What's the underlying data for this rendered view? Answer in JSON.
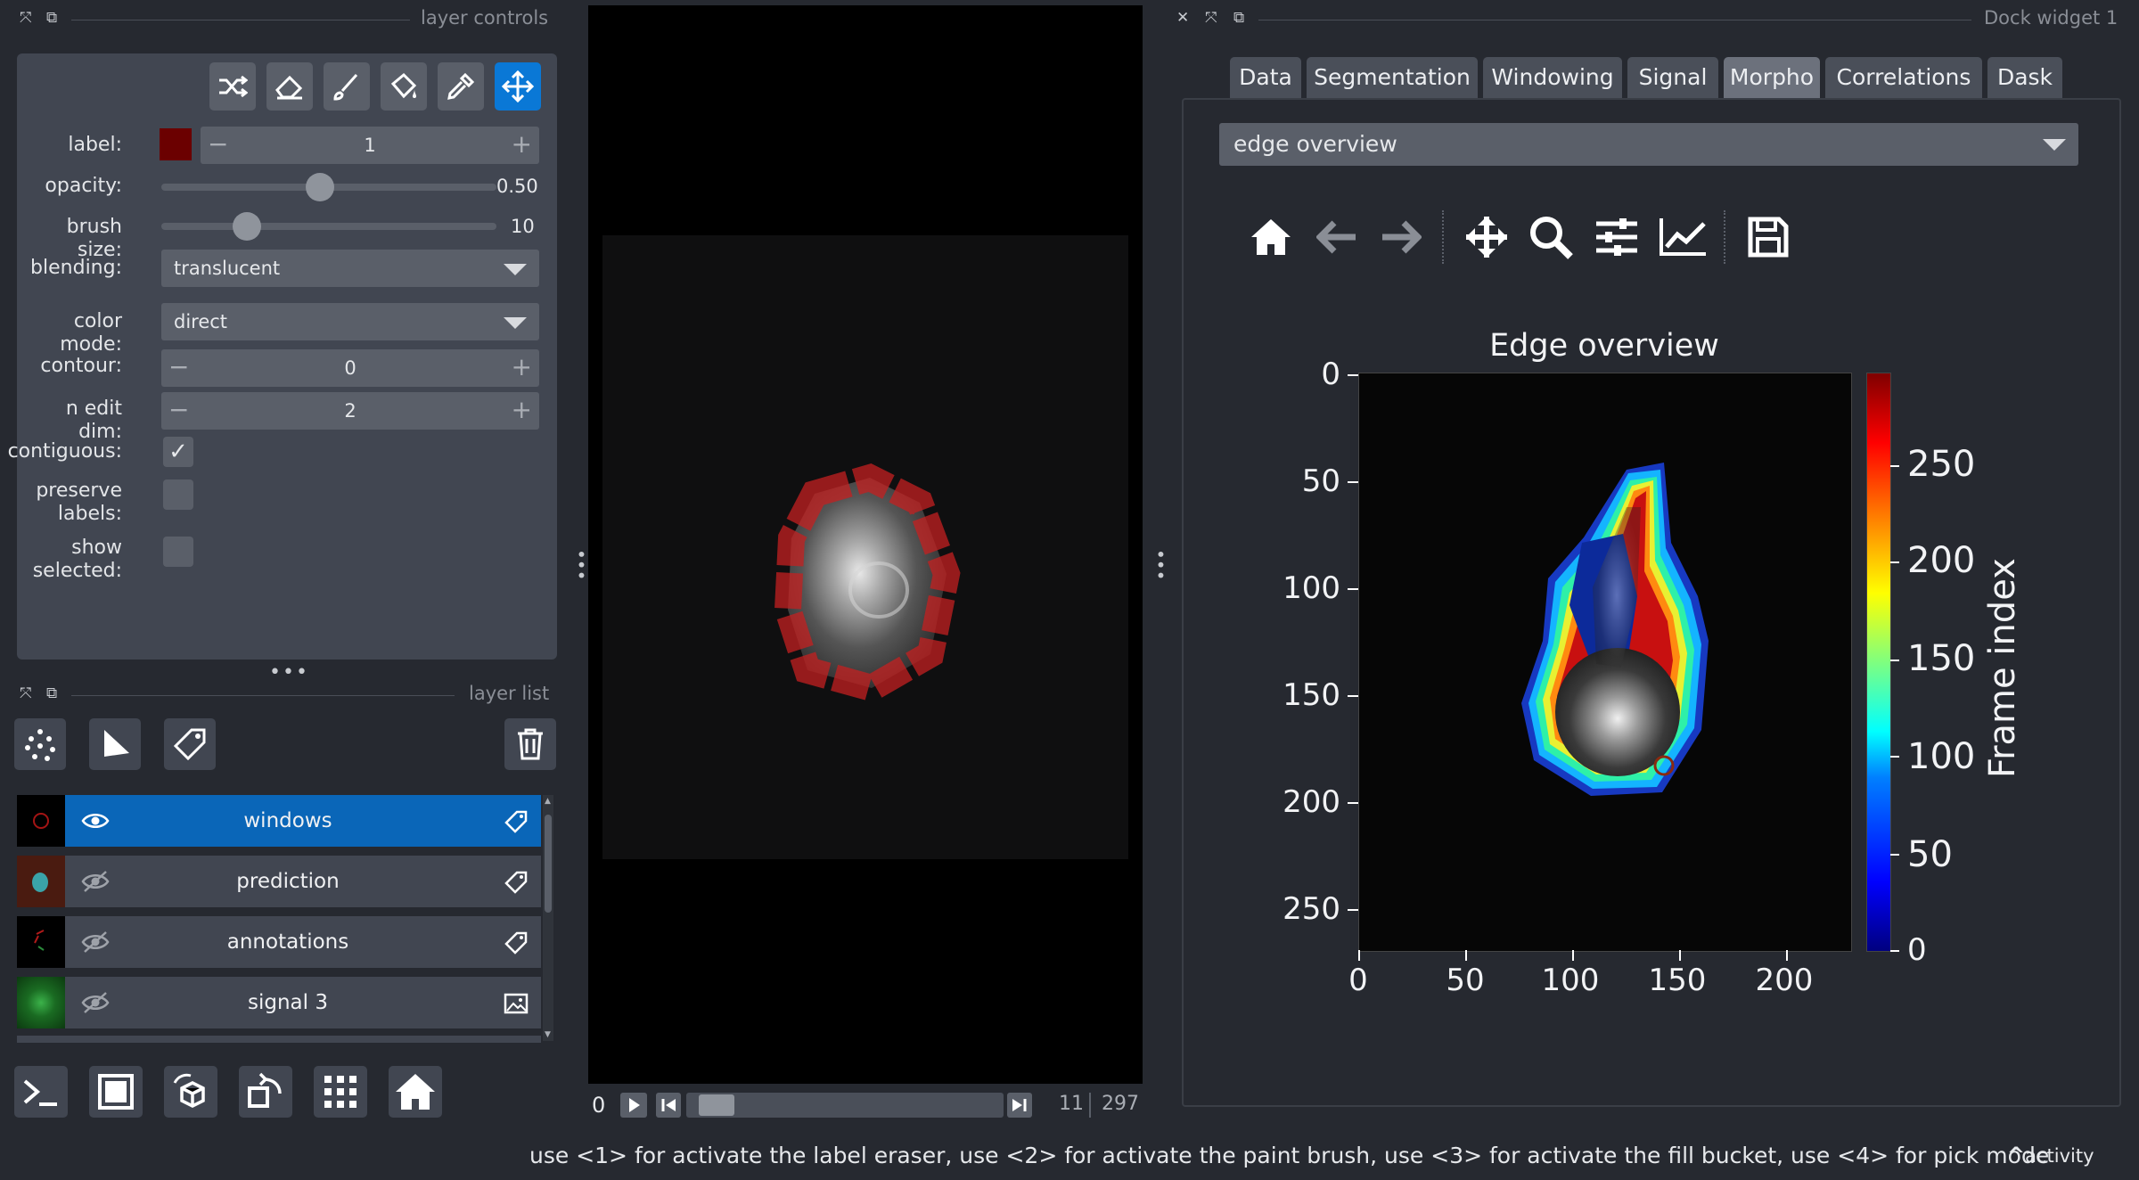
{
  "layer_controls": {
    "header_title": "layer controls",
    "label_label": "label:",
    "label_value": "1",
    "label_color": "#6b0000",
    "opacity_label": "opacity:",
    "opacity_value": "0.50",
    "opacity_fraction": 0.5,
    "brush_size_label": "brush size:",
    "brush_size_value": "10",
    "blending_label": "blending:",
    "blending_value": "translucent",
    "color_mode_label": "color mode:",
    "color_mode_value": "direct",
    "contour_label": "contour:",
    "contour_value": "0",
    "n_edit_dim_label": "n edit dim:",
    "n_edit_dim_value": "2",
    "contiguous_label": "contiguous:",
    "contiguous_checked": true,
    "preserve_labels_label": "preserve labels:",
    "show_selected_label": "show selected:",
    "tools": [
      "shuffle-icon",
      "eraser-icon",
      "paint-brush-icon",
      "fill-bucket-icon",
      "color-picker-icon",
      "pan-zoom-icon"
    ],
    "active_tool": "pan-zoom-icon"
  },
  "layer_list": {
    "header_title": "layer list",
    "layers": [
      {
        "name": "windows",
        "selected": true,
        "visible": true,
        "type": "labels"
      },
      {
        "name": "prediction",
        "selected": false,
        "visible": false,
        "type": "labels"
      },
      {
        "name": "annotations",
        "selected": false,
        "visible": false,
        "type": "labels"
      },
      {
        "name": "signal 3",
        "selected": false,
        "visible": false,
        "type": "image"
      }
    ]
  },
  "viewer": {
    "frame_start": "0",
    "current_frame": "11",
    "total_frames": "297"
  },
  "dock": {
    "header_title": "Dock widget 1",
    "tabs": [
      "Data",
      "Segmentation",
      "Windowing",
      "Signal",
      "Morpho",
      "Correlations",
      "Dask"
    ],
    "active_tab": "Morpho",
    "plot_select_value": "edge overview",
    "toolbar": [
      "home-icon",
      "back-arrow-icon",
      "forward-arrow-icon",
      "pan-icon",
      "zoom-icon",
      "configure-subplots-icon",
      "edit-axes-icon",
      "save-icon"
    ]
  },
  "chart_data": {
    "type": "heatmap",
    "title": "Edge overview",
    "x_ticks": [
      "0",
      "50",
      "100",
      "150",
      "200"
    ],
    "y_ticks": [
      "0",
      "50",
      "100",
      "150",
      "200",
      "250"
    ],
    "xlim": [
      0,
      230
    ],
    "ylim": [
      270,
      0
    ],
    "colorbar_label": "Frame index",
    "colorbar_ticks": [
      "0",
      "50",
      "100",
      "150",
      "200",
      "250"
    ],
    "colorbar_range": [
      0,
      290
    ],
    "colormap": "jet"
  },
  "status": {
    "message": "use <1> for activate the label eraser, use <2> for activate the paint brush, use <3> for activate the fill bucket, use <4> for pick mode",
    "activity_label": "activity"
  }
}
